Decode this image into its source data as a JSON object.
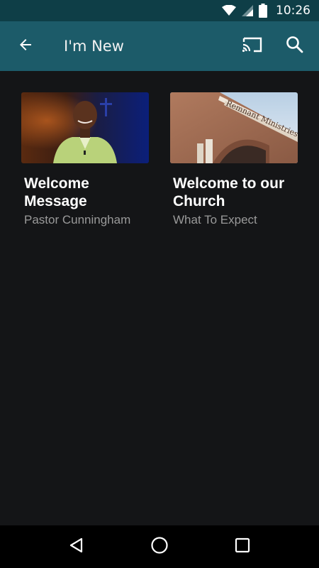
{
  "status_bar": {
    "time": "10:26",
    "icons": [
      "wifi-icon",
      "cell-signal-icon",
      "battery-icon"
    ]
  },
  "app_bar": {
    "title": "I'm New",
    "icons": [
      "back-arrow-icon",
      "cast-icon",
      "search-icon"
    ],
    "color": "#1c5b69"
  },
  "cards": [
    {
      "title": "Welcome\nMessage",
      "subtitle": "Pastor Cunningham"
    },
    {
      "title": "Welcome to our\nChurch",
      "subtitle": "What To Expect",
      "building_sign": "Remnant Ministries"
    }
  ],
  "nav_bar": {
    "icons": [
      "back-triangle-icon",
      "home-circle-icon",
      "recents-square-icon"
    ]
  }
}
